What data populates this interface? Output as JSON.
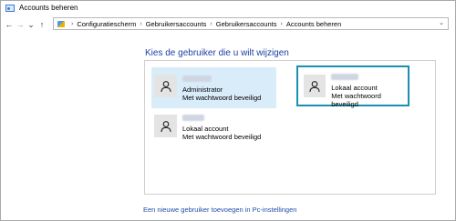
{
  "window": {
    "title": "Accounts beheren"
  },
  "nav": {
    "back": "←",
    "forward": "→",
    "recent": "⌄",
    "up": "↑"
  },
  "breadcrumb": {
    "items": [
      "Configuratiescherm",
      "Gebruikersaccounts",
      "Gebruikersaccounts",
      "Accounts beheren"
    ],
    "separator": "›"
  },
  "main": {
    "heading": "Kies de gebruiker die u wilt wijzigen",
    "accounts": [
      {
        "type": "Administrator",
        "status": "Met wachtwoord beveiligd"
      },
      {
        "type": "Lokaal account",
        "status": "Met wachtwoord beveiligd"
      },
      {
        "type": "Lokaal account",
        "status": "Met wachtwoord beveiligd"
      }
    ],
    "add_user_link": "Een nieuwe gebruiker toevoegen in Pc-instellingen"
  },
  "colors": {
    "heading": "#1e3ea5",
    "link": "#1e4ea8",
    "selected_bg": "#d9ecfa",
    "focus_border": "#1a8fb0"
  }
}
